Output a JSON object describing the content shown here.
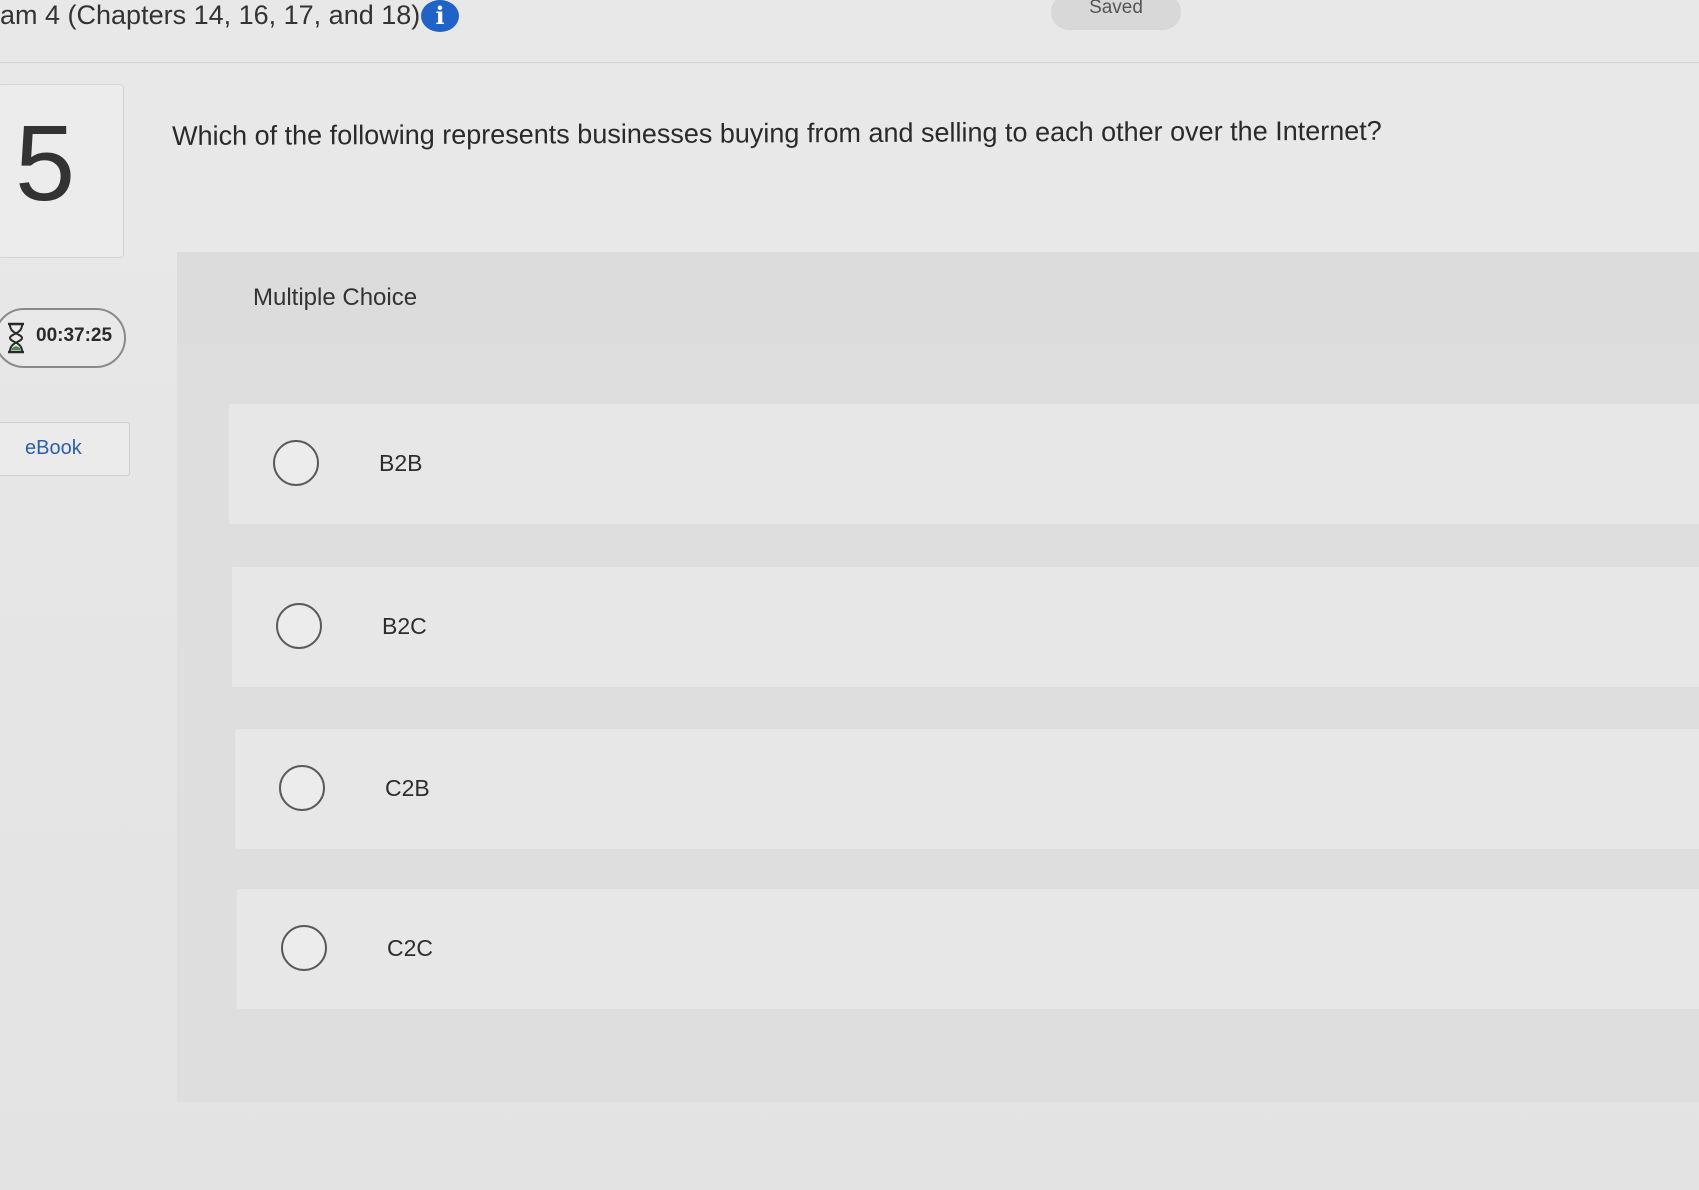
{
  "header": {
    "exam_title": "am 4 (Chapters 14, 16, 17, and 18)",
    "info_icon": "info-icon",
    "saved_label": "Saved"
  },
  "sidebar": {
    "question_number": "5",
    "timer": "00:37:25",
    "timer_icon": "hourglass-icon",
    "ebook_label": "eBook"
  },
  "question": {
    "text": "Which of the following represents businesses buying from and selling to each other over the Internet?",
    "type_label": "Multiple Choice",
    "options": [
      {
        "label": "B2B",
        "selected": false
      },
      {
        "label": "B2C",
        "selected": false
      },
      {
        "label": "C2B",
        "selected": false
      },
      {
        "label": "C2C",
        "selected": false
      }
    ]
  },
  "colors": {
    "accent": "#1f63c6",
    "link": "#2b5fa8",
    "background": "#e6e6e6"
  }
}
